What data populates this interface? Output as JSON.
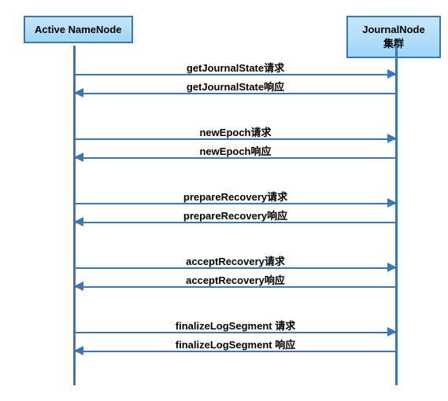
{
  "participants": {
    "left": "Active NameNode",
    "right": "JournalNode集群"
  },
  "messages": [
    {
      "label": "getJournalState请求",
      "dir": "right"
    },
    {
      "label": "getJournalState响应",
      "dir": "left"
    },
    {
      "label": "newEpoch请求",
      "dir": "right"
    },
    {
      "label": "newEpoch响应",
      "dir": "left"
    },
    {
      "label": "prepareRecovery请求",
      "dir": "right"
    },
    {
      "label": "prepareRecovery响应",
      "dir": "left"
    },
    {
      "label": "acceptRecovery请求",
      "dir": "right"
    },
    {
      "label": "acceptRecovery响应",
      "dir": "left"
    },
    {
      "label": "finalizeLogSegment 请求",
      "dir": "right"
    },
    {
      "label": "finalizeLogSegment 响应",
      "dir": "left"
    }
  ],
  "chart_data": {
    "type": "sequence-diagram",
    "participants": [
      "Active NameNode",
      "JournalNode集群"
    ],
    "interactions": [
      {
        "from": "Active NameNode",
        "to": "JournalNode集群",
        "message": "getJournalState请求"
      },
      {
        "from": "JournalNode集群",
        "to": "Active NameNode",
        "message": "getJournalState响应"
      },
      {
        "from": "Active NameNode",
        "to": "JournalNode集群",
        "message": "newEpoch请求"
      },
      {
        "from": "JournalNode集群",
        "to": "Active NameNode",
        "message": "newEpoch响应"
      },
      {
        "from": "Active NameNode",
        "to": "JournalNode集群",
        "message": "prepareRecovery请求"
      },
      {
        "from": "JournalNode集群",
        "to": "Active NameNode",
        "message": "prepareRecovery响应"
      },
      {
        "from": "Active NameNode",
        "to": "JournalNode集群",
        "message": "acceptRecovery请求"
      },
      {
        "from": "JournalNode集群",
        "to": "Active NameNode",
        "message": "acceptRecovery响应"
      },
      {
        "from": "Active NameNode",
        "to": "JournalNode集群",
        "message": "finalizeLogSegment 请求"
      },
      {
        "from": "JournalNode集群",
        "to": "Active NameNode",
        "message": "finalizeLogSegment 响应"
      }
    ]
  }
}
